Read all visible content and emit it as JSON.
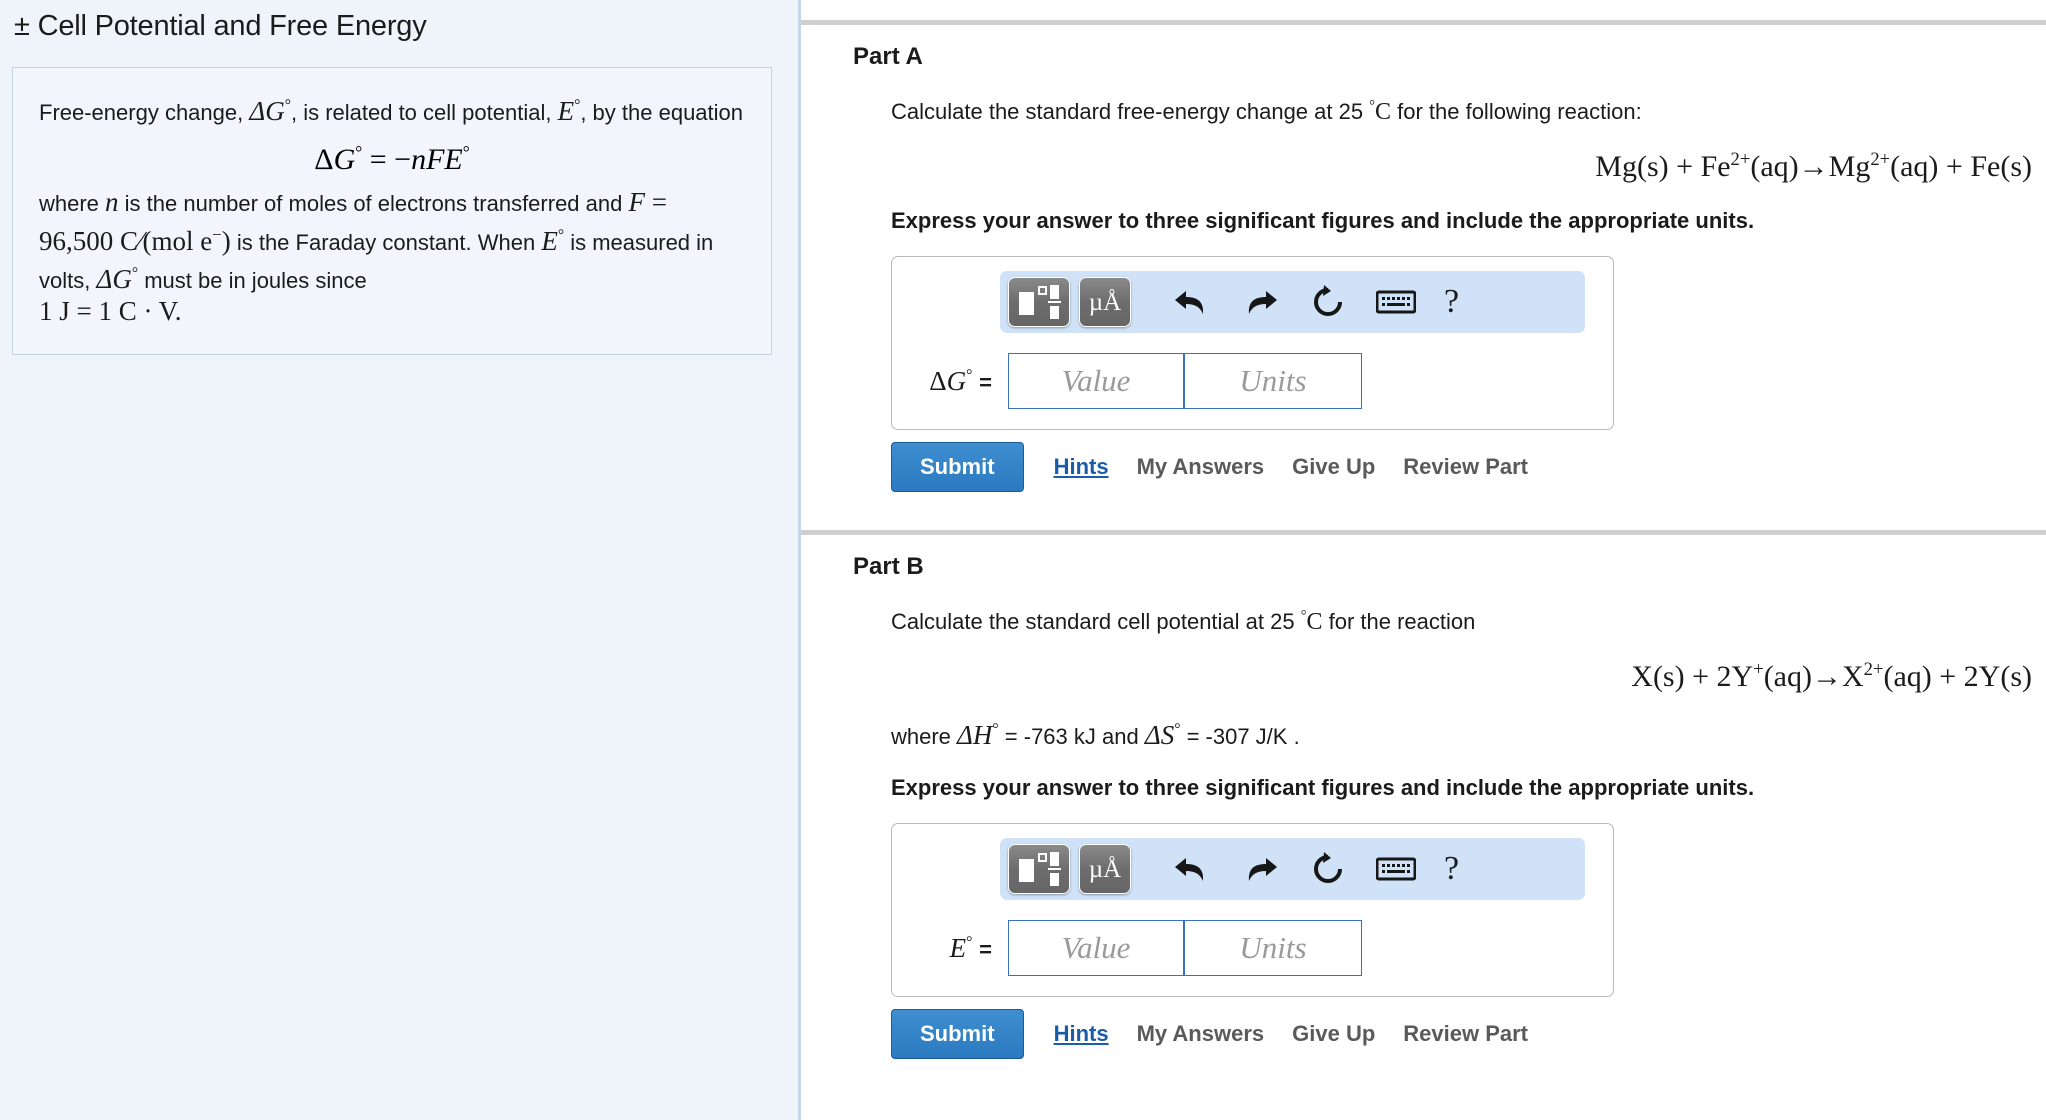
{
  "left": {
    "title": "± Cell Potential and Free Energy",
    "intro_a": "Free-energy change, ",
    "dG_symbol": "ΔG",
    "intro_b": ", is related to cell potential, ",
    "E_symbol": "E",
    "intro_c": ", by the equation",
    "equation": "ΔG° = −nFE°",
    "where_a": "where ",
    "n_symbol": "n",
    "where_b": " is the number of moles of electrons transferred and ",
    "faraday": "F = 96,500 C/(mol e⁻)",
    "where_c": " is the Faraday constant. When ",
    "where_d": " is measured in volts, ",
    "where_e": " must be in joules since ",
    "joule_eq": "1 J = 1 C · V."
  },
  "parts": [
    {
      "label": "Part A",
      "prompt_pre": "Calculate the standard free-energy change at 25 ",
      "prompt_temp": "°C",
      "prompt_post": " for the following reaction:",
      "reaction": "Mg(s) + Fe2+(aq)→Mg2+(aq) + Fe(s)",
      "reaction_parts": {
        "r1": "Mg(s) + Fe",
        "r1sup": "2+",
        "r2": "(aq)→Mg",
        "r2sup": "2+",
        "r3": "(aq) + Fe(s)"
      },
      "where_note": "",
      "express": "Express your answer to three significant figures and include the appropriate units.",
      "answer_symbol": "ΔG",
      "answer_degree": "°",
      "answer_equals": "=",
      "value_placeholder": "Value",
      "units_placeholder": "Units",
      "toolbar": {
        "template_icon": "math-template-icon",
        "units_icon": "µÅ",
        "undo_icon": "undo-icon",
        "redo_icon": "redo-icon",
        "reset_icon": "reset-icon",
        "keyboard_icon": "keyboard-icon",
        "help_icon": "?"
      },
      "submit": "Submit",
      "hints": "Hints",
      "my_answers": "My Answers",
      "give_up": "Give Up",
      "review_part": "Review Part"
    },
    {
      "label": "Part B",
      "prompt_pre": "Calculate the standard cell potential at 25 ",
      "prompt_temp": "°C",
      "prompt_post": " for the reaction",
      "reaction": "X(s) + 2Y+(aq)→X2+(aq) + 2Y(s)",
      "reaction_parts": {
        "r1": "X(s) + 2Y",
        "r1sup": "+",
        "r2": "(aq)→X",
        "r2sup": "2+",
        "r3": "(aq) + 2Y(s)"
      },
      "where_pre": "where ",
      "where_dH": "ΔH°",
      "where_mid1": " = -763 kJ and ",
      "where_dS": "ΔS°",
      "where_mid2": " = -307 J/K .",
      "express": "Express your answer to three significant figures and include the appropriate units.",
      "answer_symbol": "E",
      "answer_degree": "°",
      "answer_equals": "=",
      "value_placeholder": "Value",
      "units_placeholder": "Units",
      "toolbar": {
        "template_icon": "math-template-icon",
        "units_icon": "µÅ",
        "undo_icon": "undo-icon",
        "redo_icon": "redo-icon",
        "reset_icon": "reset-icon",
        "keyboard_icon": "keyboard-icon",
        "help_icon": "?"
      },
      "submit": "Submit",
      "hints": "Hints",
      "my_answers": "My Answers",
      "give_up": "Give Up",
      "review_part": "Review Part"
    }
  ],
  "colors": {
    "panel_bg": "#eff4fb",
    "toolbar_bg": "#cfe2f7",
    "submit_blue": "#2b7ac0",
    "link_blue": "#1a5ca8",
    "field_border": "#3b6fc4",
    "divider": "#cfcfcf"
  }
}
